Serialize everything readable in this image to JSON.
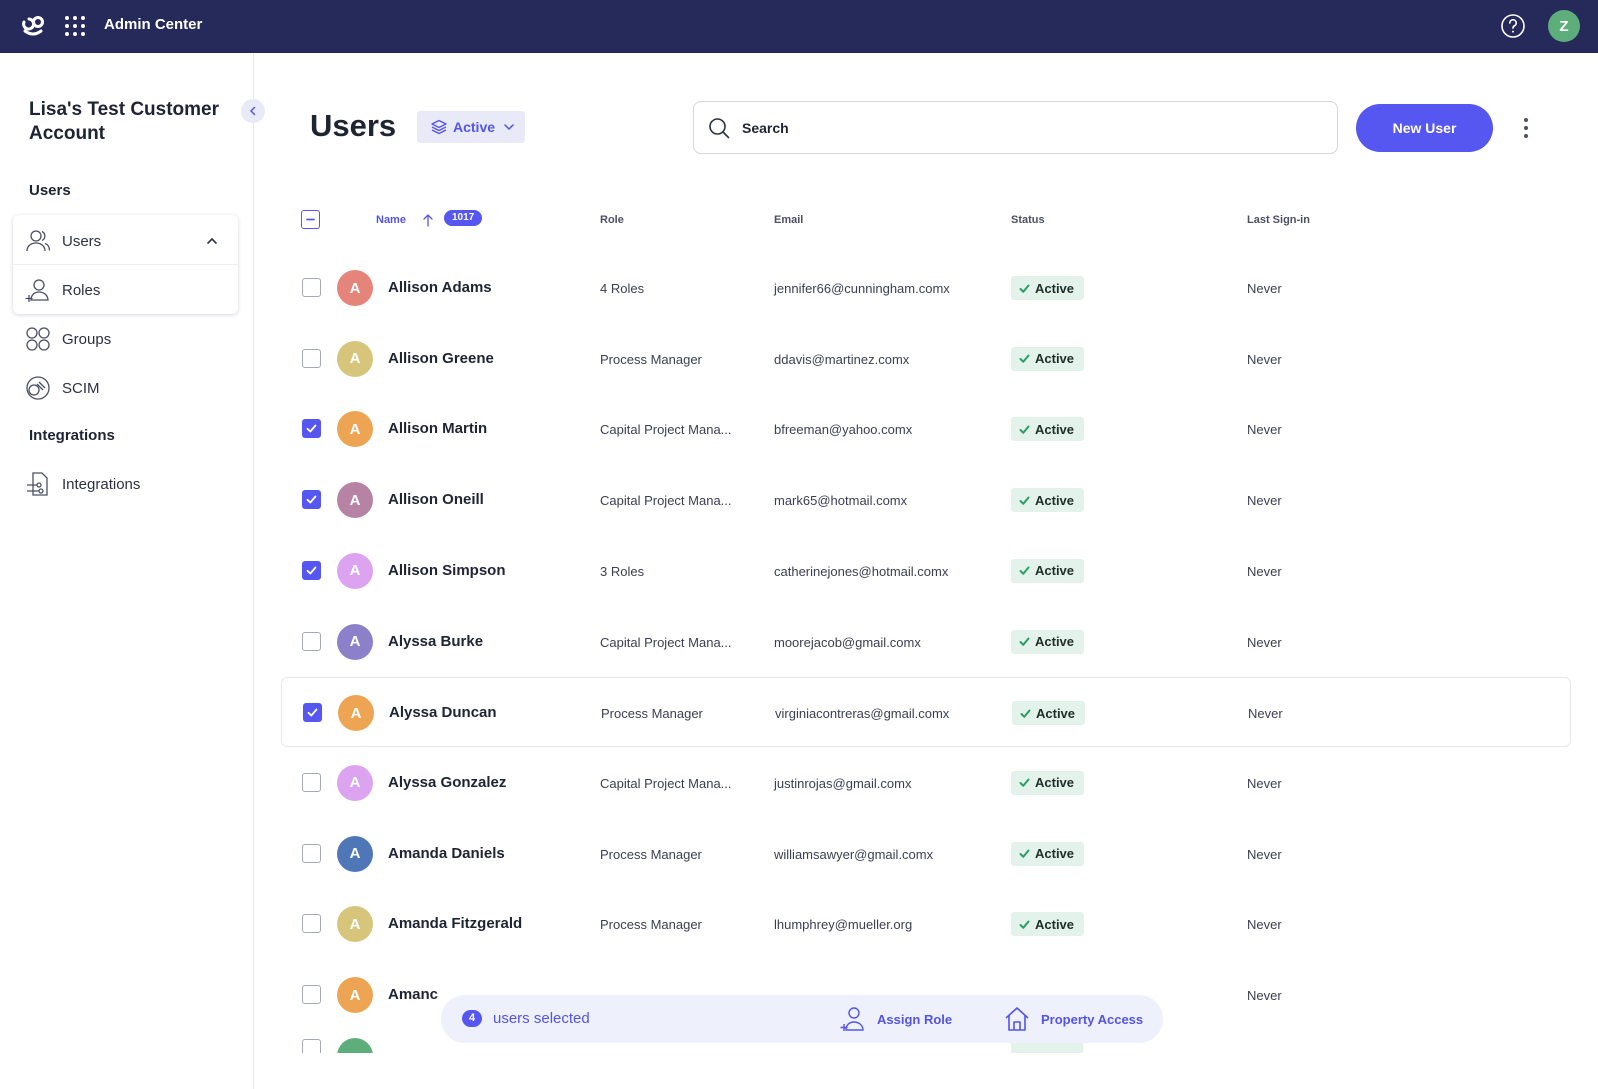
{
  "header": {
    "app_title": "Admin Center",
    "user_initial": "Z"
  },
  "sidebar": {
    "account_name": "Lisa's Test Customer Account",
    "users_section": "Users",
    "items": [
      {
        "label": "Users",
        "icon": "users-icon"
      },
      {
        "label": "Roles",
        "icon": "roles-icon"
      },
      {
        "label": "Groups",
        "icon": "groups-icon"
      },
      {
        "label": "SCIM",
        "icon": "scim-icon"
      }
    ],
    "integrations_section": "Integrations",
    "integrations_item": "Integrations"
  },
  "main": {
    "title": "Users",
    "filter_label": "Active",
    "search_placeholder": "Search",
    "new_user_label": "New User"
  },
  "table": {
    "columns": {
      "name": "Name",
      "role": "Role",
      "email": "Email",
      "status": "Status",
      "last_signin": "Last Sign-in"
    },
    "total_count": "1017",
    "rows": [
      {
        "initial": "A",
        "name": "Allison Adams",
        "role": "4 Roles",
        "email": "jennifer66@cunningham.comx",
        "status": "Active",
        "last": "Never",
        "checked": false,
        "color": "#e4847b"
      },
      {
        "initial": "A",
        "name": "Allison Greene",
        "role": "Process Manager",
        "email": "ddavis@martinez.comx",
        "status": "Active",
        "last": "Never",
        "checked": false,
        "color": "#d8c57c"
      },
      {
        "initial": "A",
        "name": "Allison Martin",
        "role": "Capital Project Mana...",
        "email": "bfreeman@yahoo.comx",
        "status": "Active",
        "last": "Never",
        "checked": true,
        "color": "#eda553"
      },
      {
        "initial": "A",
        "name": "Allison Oneill",
        "role": "Capital Project Mana...",
        "email": "mark65@hotmail.comx",
        "status": "Active",
        "last": "Never",
        "checked": true,
        "color": "#b783a4"
      },
      {
        "initial": "A",
        "name": "Allison Simpson",
        "role": "3 Roles",
        "email": "catherinejones@hotmail.comx",
        "status": "Active",
        "last": "Never",
        "checked": true,
        "color": "#dca3f0"
      },
      {
        "initial": "A",
        "name": "Alyssa Burke",
        "role": "Capital Project Mana...",
        "email": "moorejacob@gmail.comx",
        "status": "Active",
        "last": "Never",
        "checked": false,
        "color": "#8b80c9"
      },
      {
        "initial": "A",
        "name": "Alyssa Duncan",
        "role": "Process Manager",
        "email": "virginiacontreras@gmail.comx",
        "status": "Active",
        "last": "Never",
        "checked": true,
        "color": "#eda553"
      },
      {
        "initial": "A",
        "name": "Alyssa Gonzalez",
        "role": "Capital Project Mana...",
        "email": "justinrojas@gmail.comx",
        "status": "Active",
        "last": "Never",
        "checked": false,
        "color": "#dca3f0"
      },
      {
        "initial": "A",
        "name": "Amanda Daniels",
        "role": "Process Manager",
        "email": "williamsawyer@gmail.comx",
        "status": "Active",
        "last": "Never",
        "checked": false,
        "color": "#4f77b8"
      },
      {
        "initial": "A",
        "name": "Amanda Fitzgerald",
        "role": "Process Manager",
        "email": "lhumphrey@mueller.org",
        "status": "Active",
        "last": "Never",
        "checked": false,
        "color": "#d8c57c"
      },
      {
        "initial": "A",
        "name": "Amanc",
        "role": "",
        "email": "",
        "status": "",
        "last": "Never",
        "checked": false,
        "color": "#eda553"
      }
    ]
  },
  "selection_bar": {
    "count": "4",
    "text": "users selected",
    "assign_role": "Assign Role",
    "property_access": "Property Access"
  },
  "colors": {
    "accent": "#5656f0",
    "topbar": "#252a5a",
    "status_bg": "#e3f2ea"
  }
}
